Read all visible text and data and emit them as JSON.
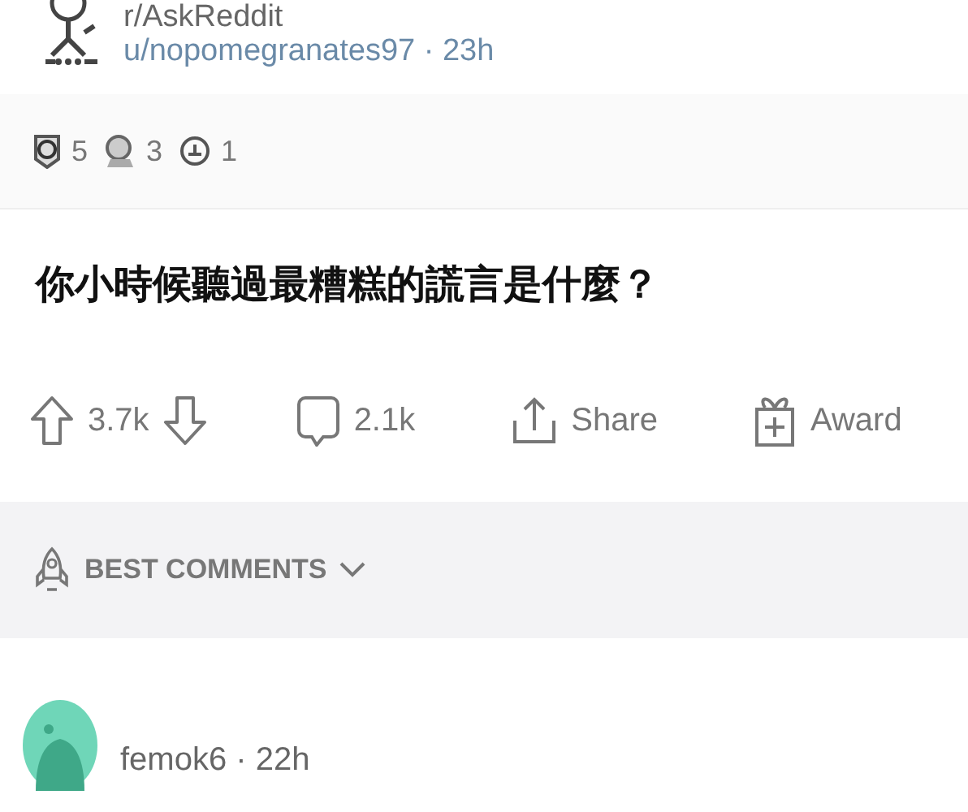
{
  "post": {
    "subreddit": "r/AskReddit",
    "meta": "u/nopomegranates97 · 23h",
    "awards": [
      {
        "count": "5"
      },
      {
        "count": "3"
      },
      {
        "count": "1"
      }
    ],
    "title": "你小時候聽過最糟糕的謊言是什麼？",
    "actions": {
      "votes": "3.7k",
      "comments": "2.1k",
      "share": "Share",
      "award": "Award"
    }
  },
  "sort": {
    "label": "BEST COMMENTS"
  },
  "comment": {
    "meta": "femok6 · 22h"
  }
}
